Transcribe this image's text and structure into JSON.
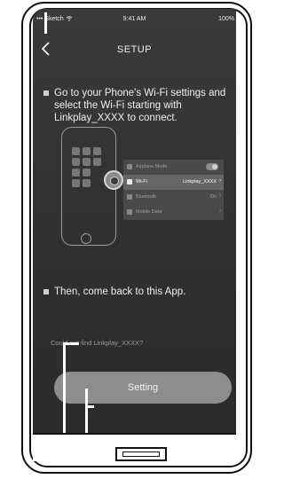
{
  "status_bar": {
    "carrier": "••• Sketch",
    "wifi_icon": "wifi-icon",
    "time": "9:41 AM",
    "battery": "100%"
  },
  "nav": {
    "back_icon": "chevron-left-icon",
    "title": "SETUP"
  },
  "steps": [
    {
      "text": "Go to your Phone's Wi-Fi settings and select the Wi-Fi starting with Linkplay_XXXX to connect."
    },
    {
      "text": "Then, come back to this App."
    }
  ],
  "illustration": {
    "settings_rows": [
      {
        "label": "Airplane Mode",
        "value": ""
      },
      {
        "label": "Wi-Fi",
        "value": "Linkplay_XXXX"
      },
      {
        "label": "Bluetooth",
        "value": "On"
      },
      {
        "label": "Mobile Data",
        "value": ""
      }
    ]
  },
  "help_link": "Could not find Linkplay_XXXX?",
  "setting_button": "Setting",
  "colors": {
    "screen_bg": "#333333",
    "button_bg": "#8d8d8d",
    "text": "#efefef"
  }
}
